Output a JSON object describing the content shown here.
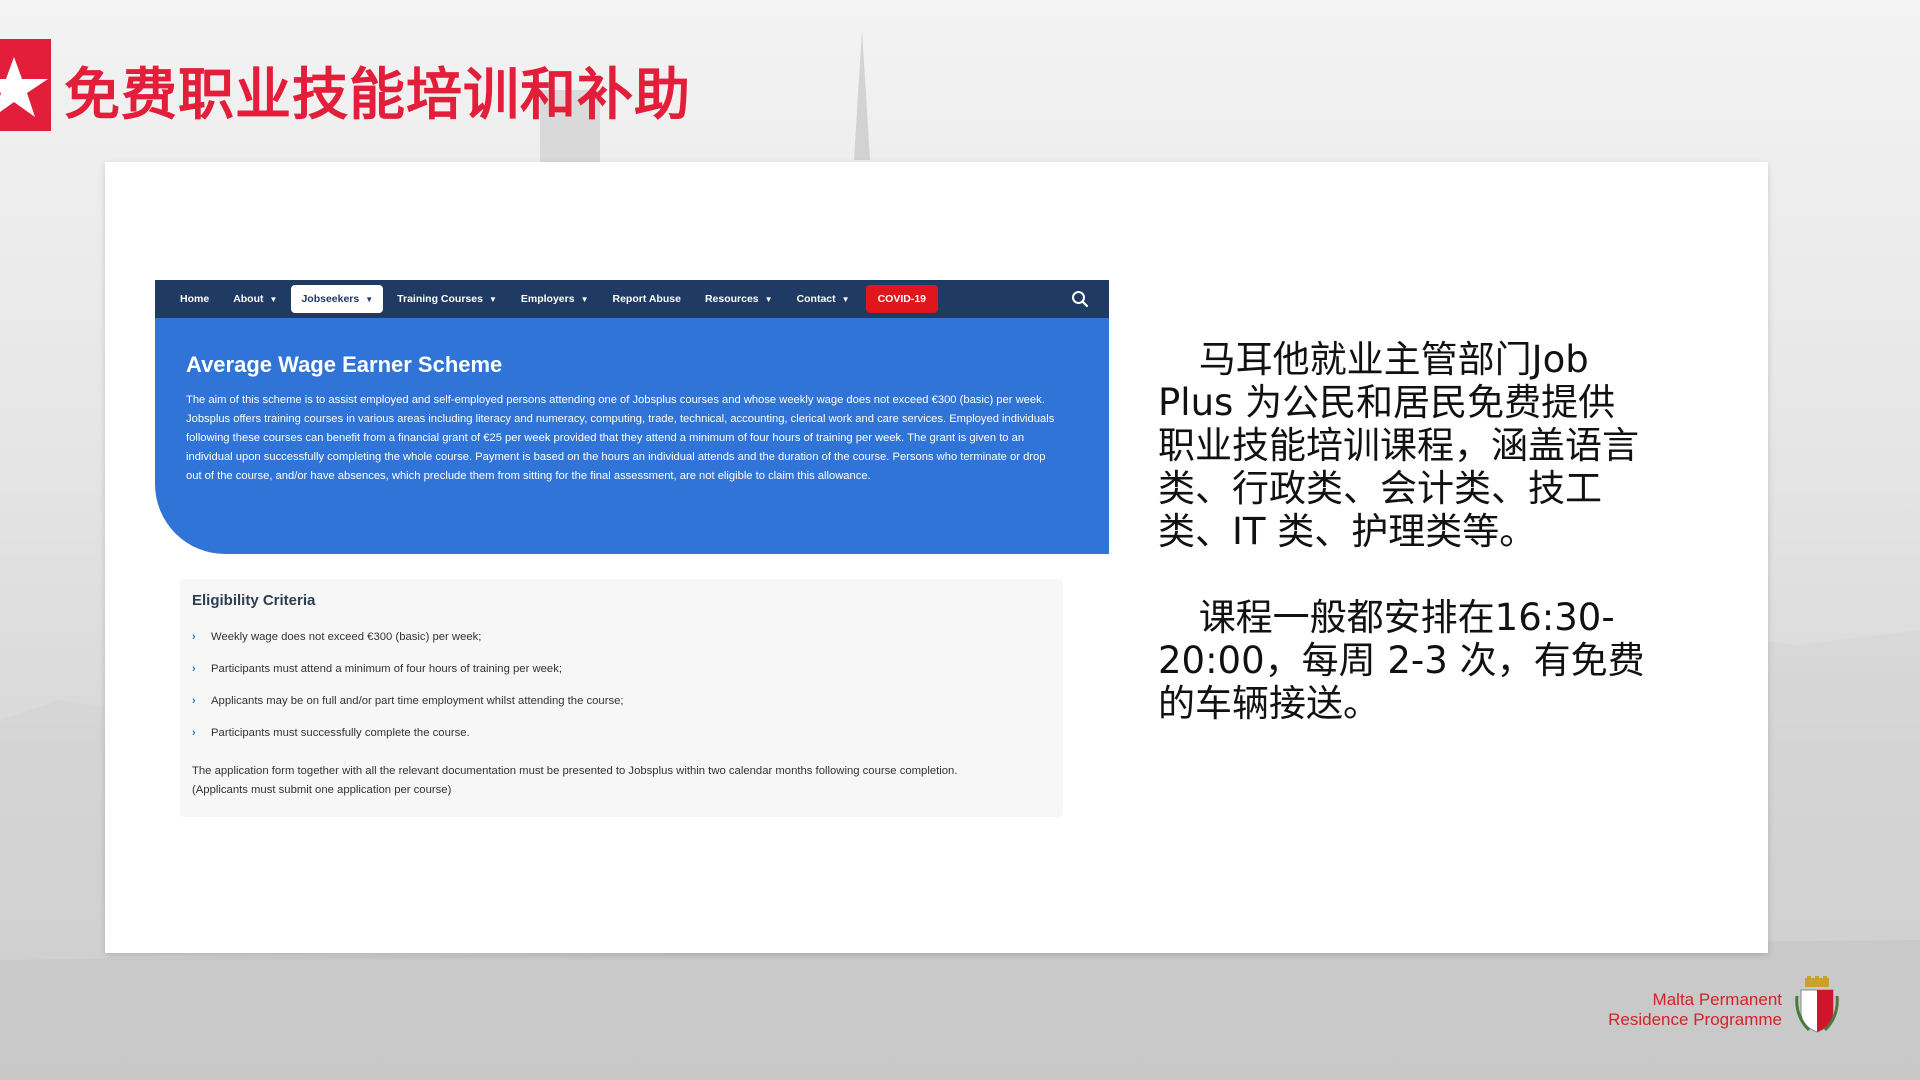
{
  "slide": {
    "title": "免费职业技能培训和补助"
  },
  "embedded_site": {
    "nav": {
      "items": [
        {
          "label": "Home",
          "dropdown": false,
          "active": false
        },
        {
          "label": "About",
          "dropdown": true,
          "active": false
        },
        {
          "label": "Jobseekers",
          "dropdown": true,
          "active": true
        },
        {
          "label": "Training Courses",
          "dropdown": true,
          "active": false
        },
        {
          "label": "Employers",
          "dropdown": true,
          "active": false
        },
        {
          "label": "Report Abuse",
          "dropdown": false,
          "active": false
        },
        {
          "label": "Resources",
          "dropdown": true,
          "active": false
        },
        {
          "label": "Contact",
          "dropdown": true,
          "active": false
        }
      ],
      "covid_label": "COVID-19",
      "search_icon": "search-icon"
    },
    "hero": {
      "title": "Average Wage Earner Scheme",
      "body": "The aim of this scheme is to assist employed and self-employed persons attending one of Jobsplus courses and whose weekly wage does not exceed €300 (basic) per week. Jobsplus offers training courses in various areas including literacy and numeracy, computing, trade, technical, accounting, clerical work and care services. Employed individuals following these courses can benefit from a financial grant of €25 per week provided that they attend a minimum of four hours of training per week. The grant is given to an individual upon successfully completing the whole course.  Payment is based on the hours an individual attends and the duration of the course.  Persons who terminate or drop out of the course, and/or have absences, which preclude them from sitting for the final assessment, are not eligible to claim this allowance."
    },
    "eligibility": {
      "title": "Eligibility Criteria",
      "items": [
        "Weekly wage does not exceed €300 (basic) per week;",
        "Participants must attend a minimum of four hours of training per week;",
        "Applicants may be on full and/or part time employment whilst attending the course;",
        "Participants must successfully complete the course."
      ],
      "note_line1": "The application form together with all the relevant documentation must be presented to Jobsplus within two calendar months following course completion.",
      "note_line2": "(Applicants must submit one application per course)"
    }
  },
  "description": {
    "paragraph1": "马耳他就业主管部门Job Plus 为公民和居民免费提供职业技能培训课程，涵盖语言类、行政类、会计类、技工类、IT 类、护理类等。",
    "paragraph2": "课程一般都安排在16:30-20:00，每周 2-3 次，有免费的车辆接送。"
  },
  "footer": {
    "brand_line1": "Malta Permanent",
    "brand_line2": "Residence Programme",
    "crest_icon": "malta-crest-icon"
  },
  "colors": {
    "accent_red": "#e31e3a",
    "nav_bg": "#1f3a63",
    "hero_bg": "#2f74d6",
    "covid_red": "#e0161d"
  }
}
